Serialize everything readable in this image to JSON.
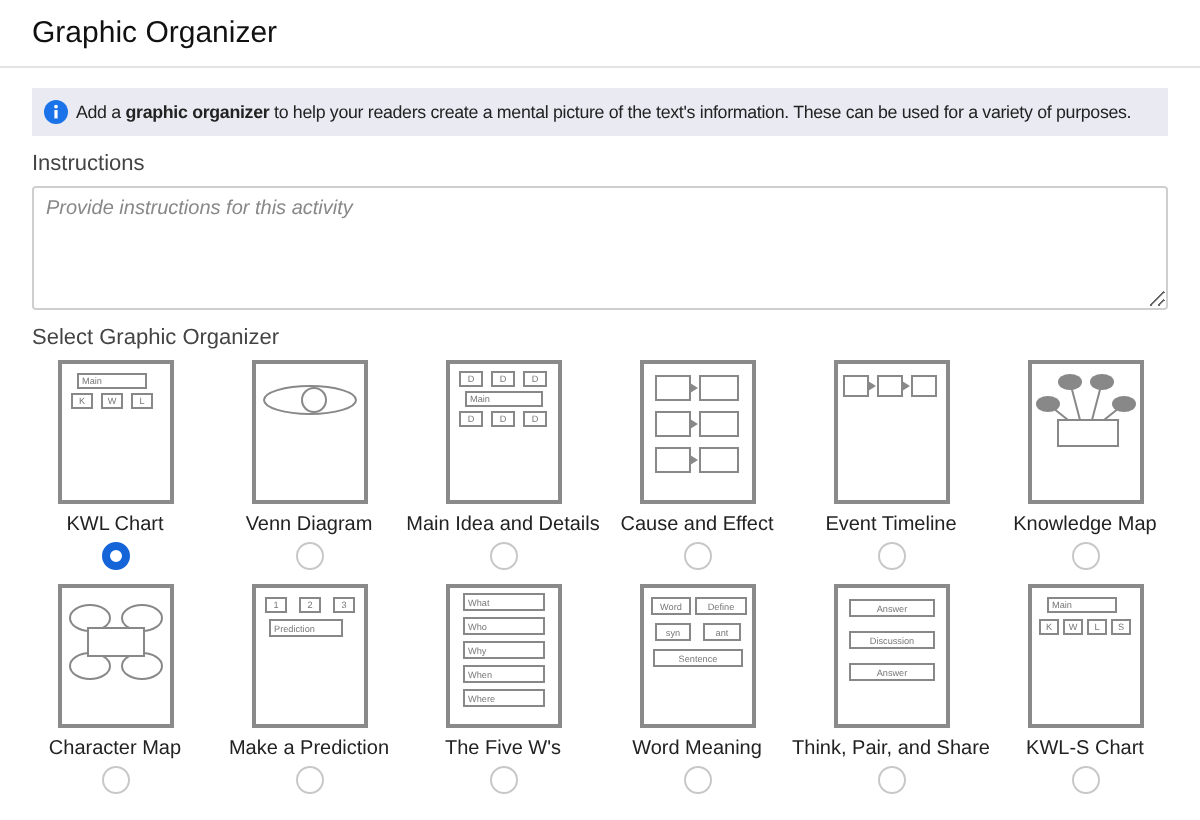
{
  "header": {
    "title": "Graphic Organizer"
  },
  "info_banner": {
    "text": "Add a **graphic organizer** to help your readers create a mental picture of the text's information. These can be used for a variety of purposes."
  },
  "instructions": {
    "label": "Instructions",
    "placeholder": "Provide instructions for this activity"
  },
  "organizers": {
    "label": "Select Graphic Organizer",
    "items": [
      {
        "kind": "kwl",
        "name": "KWL Chart",
        "selected": true,
        "thumb_labels": [
          "Main",
          "K",
          "W",
          "L"
        ]
      },
      {
        "kind": "venn",
        "name": "Venn Diagram",
        "selected": false
      },
      {
        "kind": "main_idea",
        "name": "Main Idea and Details",
        "selected": false,
        "thumb_labels": [
          "D",
          "D",
          "D",
          "Main",
          "D",
          "D",
          "D"
        ]
      },
      {
        "kind": "cause_effect",
        "name": "Cause and Effect",
        "selected": false
      },
      {
        "kind": "timeline",
        "name": "Event Timeline",
        "selected": false
      },
      {
        "kind": "knowledge_map",
        "name": "Knowledge Map",
        "selected": false
      },
      {
        "kind": "character_map",
        "name": "Character Map",
        "selected": false
      },
      {
        "kind": "prediction",
        "name": "Make a Prediction",
        "selected": false,
        "thumb_labels": [
          "1",
          "2",
          "3",
          "Prediction"
        ]
      },
      {
        "kind": "five_ws",
        "name": "The Five W's",
        "selected": false,
        "thumb_labels": [
          "What",
          "Who",
          "Why",
          "When",
          "Where"
        ]
      },
      {
        "kind": "word_meaning",
        "name": "Word Meaning",
        "selected": false,
        "thumb_labels": [
          "Word",
          "Define",
          "syn",
          "ant",
          "Sentence"
        ]
      },
      {
        "kind": "think_pair_share",
        "name": "Think, Pair, and Share",
        "selected": false,
        "thumb_labels": [
          "Answer",
          "Discussion",
          "Answer"
        ]
      },
      {
        "kind": "kwls",
        "name": "KWL-S Chart",
        "selected": false,
        "thumb_labels": [
          "Main",
          "K",
          "W",
          "L",
          "S"
        ]
      }
    ]
  }
}
